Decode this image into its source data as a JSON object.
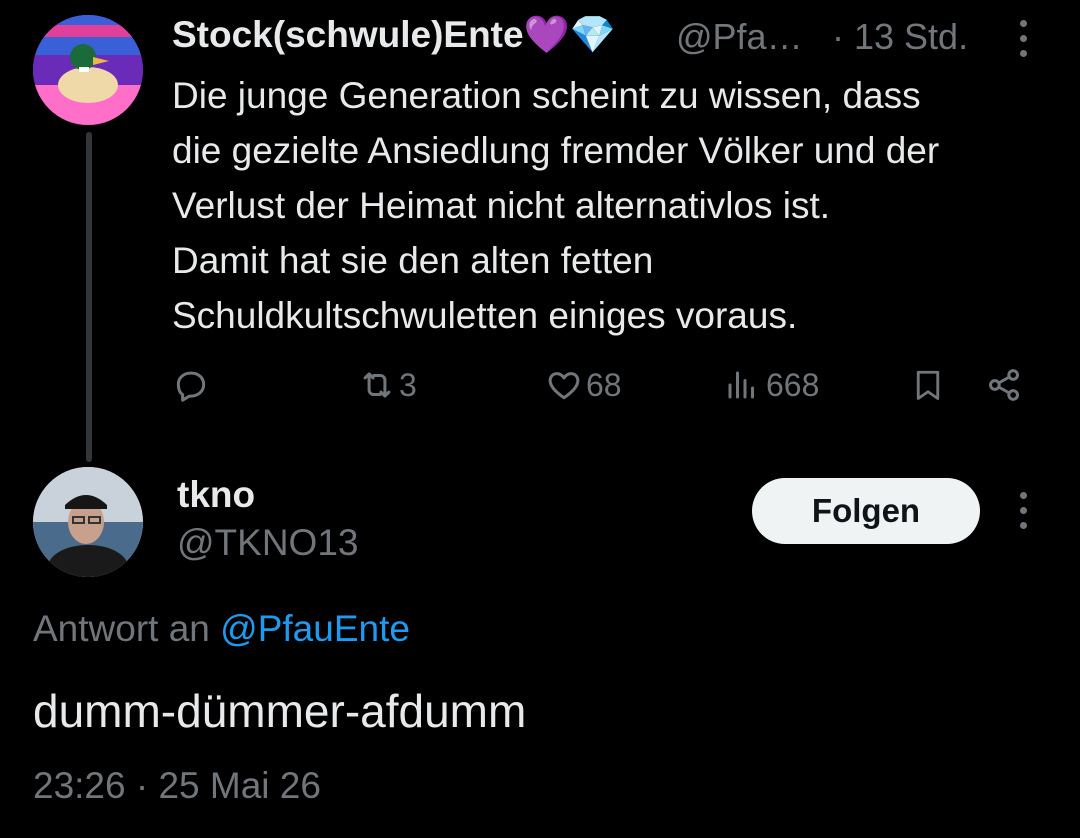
{
  "parent_tweet": {
    "display_name": "Stock(schwule)Ente💜💎",
    "handle": "@Pfa…",
    "time": "· 13 Std.",
    "text_lines": [
      "Die junge Generation scheint zu wissen, dass",
      "die gezielte Ansiedlung fremder Völker und der",
      "Verlust der Heimat nicht alternativlos ist.",
      "Damit hat sie den alten fetten",
      "Schuldkultschwuletten einiges voraus."
    ],
    "actions": {
      "retweets": "3",
      "likes": "68",
      "views": "668"
    },
    "icons": [
      "reply-icon",
      "retweet-icon",
      "like-icon",
      "views-icon",
      "bookmark-icon",
      "share-icon",
      "more-icon"
    ]
  },
  "reply_tweet": {
    "display_name": "tkno",
    "handle": "@TKNO13",
    "follow_label": "Folgen",
    "reply_prefix": "Antwort an",
    "reply_mention": "@PfauEnte",
    "text": "dumm-dümmer-afdumm",
    "timestamp": "23:26 · 25 Mai 26"
  },
  "colors": {
    "background": "#000000",
    "text_primary": "#e7e9ea",
    "text_secondary": "#71767b",
    "link": "#1d9bf0",
    "button_bg": "#eff3f4"
  }
}
